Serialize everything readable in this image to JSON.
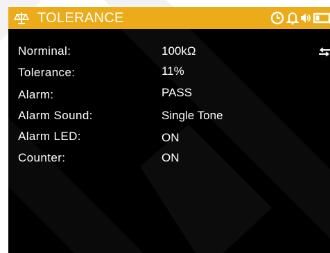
{
  "screen": {
    "title": "TOLERANCE",
    "title_icon": "scale-balance-icon",
    "status_icons": [
      "clock-icon",
      "bell-icon",
      "speaker-icon",
      "battery-icon"
    ],
    "colors": {
      "title_bar": "#ecab18",
      "background": "#000000",
      "text": "#ffffff"
    }
  },
  "settings": [
    {
      "label": "Norminal:",
      "value": "100kΩ"
    },
    {
      "label": "Tolerance:",
      "value": "11%"
    },
    {
      "label": "Alarm:",
      "value": "PASS"
    },
    {
      "label": "Alarm Sound:",
      "value": "Single Tone"
    },
    {
      "label": "Alarm LED:",
      "value": "ON"
    },
    {
      "label": "Counter:",
      "value": "ON"
    }
  ],
  "side_icon": "swap-arrows-icon"
}
